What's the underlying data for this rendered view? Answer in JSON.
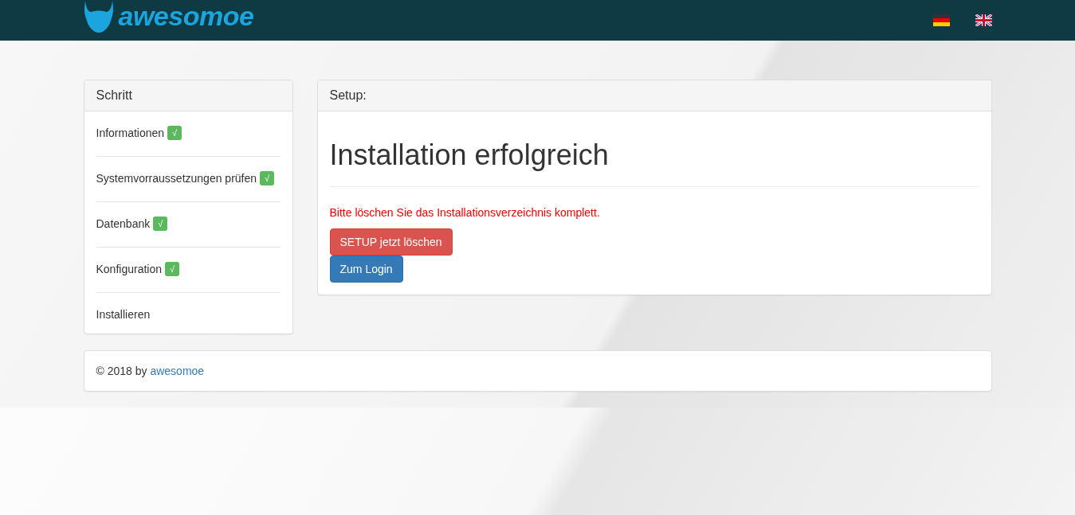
{
  "navbar": {
    "logo": "awesomoe",
    "languages": [
      {
        "kind": "de"
      },
      {
        "kind": "en"
      }
    ]
  },
  "steps": {
    "title": "Schritt",
    "items": [
      {
        "label": "Informationen",
        "badge": "√"
      },
      {
        "label": "Systemvorraussetzungen prüfen",
        "badge": "√"
      },
      {
        "label": "Datenbank",
        "badge": "√"
      },
      {
        "label": "Konfiguration",
        "badge": "√"
      },
      {
        "label": "Installieren"
      }
    ]
  },
  "setup": {
    "title": "Setup:",
    "heading": "Installation erfolgreich",
    "warning": "Bitte löschen Sie das Installationsverzeichnis komplett.",
    "buttons": [
      {
        "label": "SETUP jetzt löschen",
        "kind": "danger"
      },
      {
        "label": "Zum Login",
        "kind": "primary"
      }
    ]
  },
  "footer": {
    "text": "© 2018 by ",
    "link": "awesomoe"
  }
}
